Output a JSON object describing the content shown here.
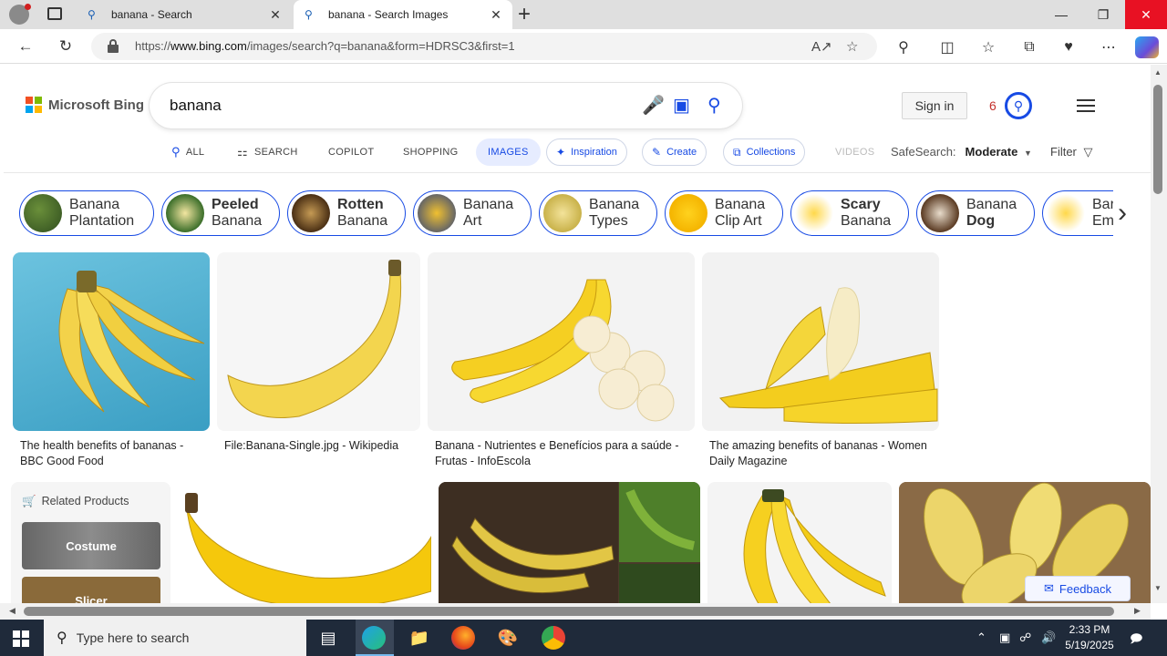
{
  "browser": {
    "tabs": [
      {
        "title": "banana - Search",
        "icon": "search-icon"
      },
      {
        "title": "banana - Search Images",
        "icon": "search-icon"
      }
    ],
    "url_prefix": "https://",
    "url_host": "www.bing.com",
    "url_path": "/images/search?q=banana&form=HDRSC3&first=1"
  },
  "bing": {
    "logo_text": "Microsoft Bing",
    "query": "banana",
    "sign_in": "Sign in",
    "rewards_count": "6",
    "scopes": {
      "all": "ALL",
      "search": "SEARCH",
      "copilot": "COPILOT",
      "shopping": "SHOPPING",
      "images": "IMAGES",
      "inspiration": "Inspiration",
      "create": "Create",
      "collections": "Collections",
      "videos": "VIDEOS"
    },
    "safesearch_label": "SafeSearch:",
    "safesearch_value": "Moderate",
    "filter": "Filter"
  },
  "related_searches": [
    {
      "line1": "Banana",
      "line2": "Plantation"
    },
    {
      "line1": "Peeled",
      "line2": "Banana"
    },
    {
      "line1": "Rotten",
      "line2": "Banana"
    },
    {
      "line1": "Banana",
      "line2": "Art"
    },
    {
      "line1": "Banana",
      "line2": "Types"
    },
    {
      "line1": "Banana",
      "line2": "Clip Art"
    },
    {
      "line1": "Scary",
      "line2": "Banana"
    },
    {
      "line1": "Banana",
      "line2": "Dog"
    },
    {
      "line1": "Bar",
      "line2": "Em"
    }
  ],
  "results": [
    {
      "caption": "The health benefits of bananas - BBC Good Food"
    },
    {
      "caption": "File:Banana-Single.jpg - Wikipedia"
    },
    {
      "caption": "Banana - Nutrientes e Benefícios para a saúde - Frutas - InfoEscola"
    },
    {
      "caption": "The amazing benefits of bananas - Women Daily Magazine"
    }
  ],
  "related_products": {
    "heading": "Related Products",
    "items": [
      "Costume",
      "Slicer"
    ]
  },
  "feedback": "Feedback",
  "taskbar": {
    "search_placeholder": "Type here to search",
    "time": "2:33 PM",
    "date": "5/19/2025"
  },
  "colors": {
    "accent": "#174ae4",
    "close_red": "#e81123",
    "taskbar": "#1f2a3a"
  }
}
